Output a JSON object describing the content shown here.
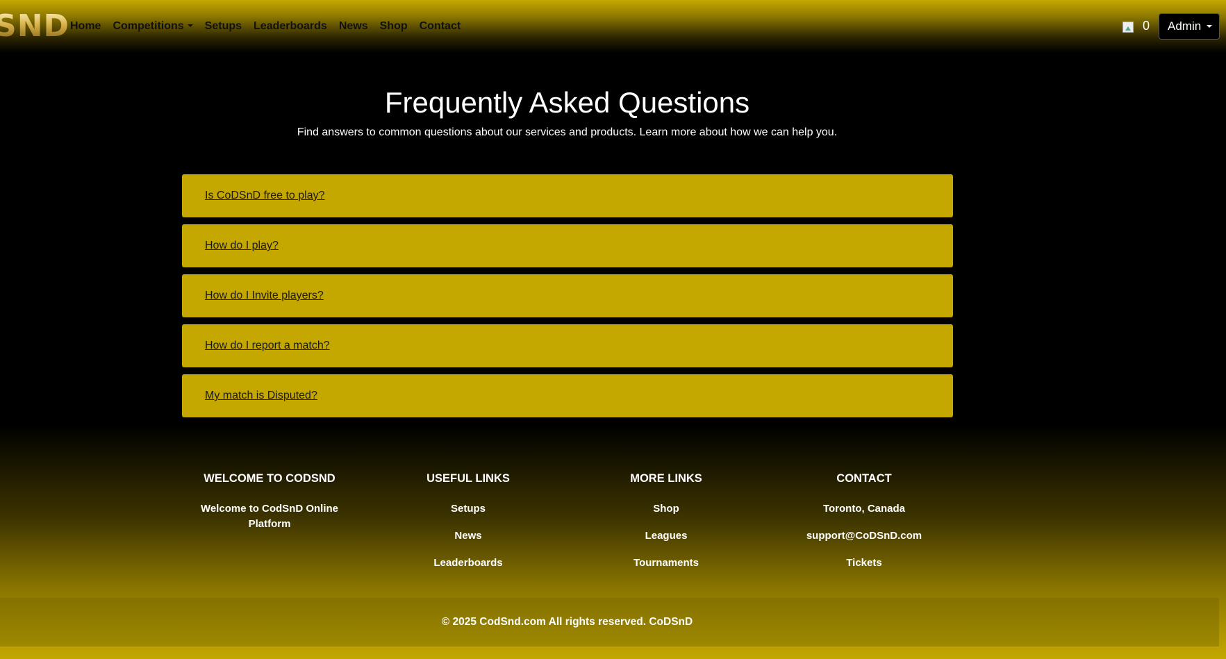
{
  "nav": {
    "logo": "SND",
    "links": [
      "Home",
      "Competitions",
      "Setups",
      "Leaderboards",
      "News",
      "Shop",
      "Contact"
    ],
    "cart_count": "0",
    "user_menu": "Admin"
  },
  "faq": {
    "title": "Frequently Asked Questions",
    "subtitle": "Find answers to common questions about our services and products. Learn more about how we can help you.",
    "questions": [
      "Is CoDSnD free to play?",
      "How do I play?",
      "How do I Invite players?",
      "How do I report a match?",
      "My match is Disputed?"
    ]
  },
  "footer": {
    "welcome": {
      "heading": "WELCOME TO CODSND",
      "text": "Welcome to CodSnD Online Platform"
    },
    "useful_links": {
      "heading": "USEFUL LINKS",
      "items": [
        "Setups",
        "News",
        "Leaderboards"
      ]
    },
    "more_links": {
      "heading": "MORE LINKS",
      "items": [
        "Shop",
        "Leagues",
        "Tournaments"
      ]
    },
    "contact": {
      "heading": "CONTACT",
      "items": [
        "Toronto, Canada",
        "support@CoDSnD.com",
        "Tickets"
      ]
    },
    "copyright": "© 2025 CodSnd.com All rights reserved. CoDSnD"
  },
  "colors": {
    "accent": "#c4a800",
    "background": "#000000"
  }
}
